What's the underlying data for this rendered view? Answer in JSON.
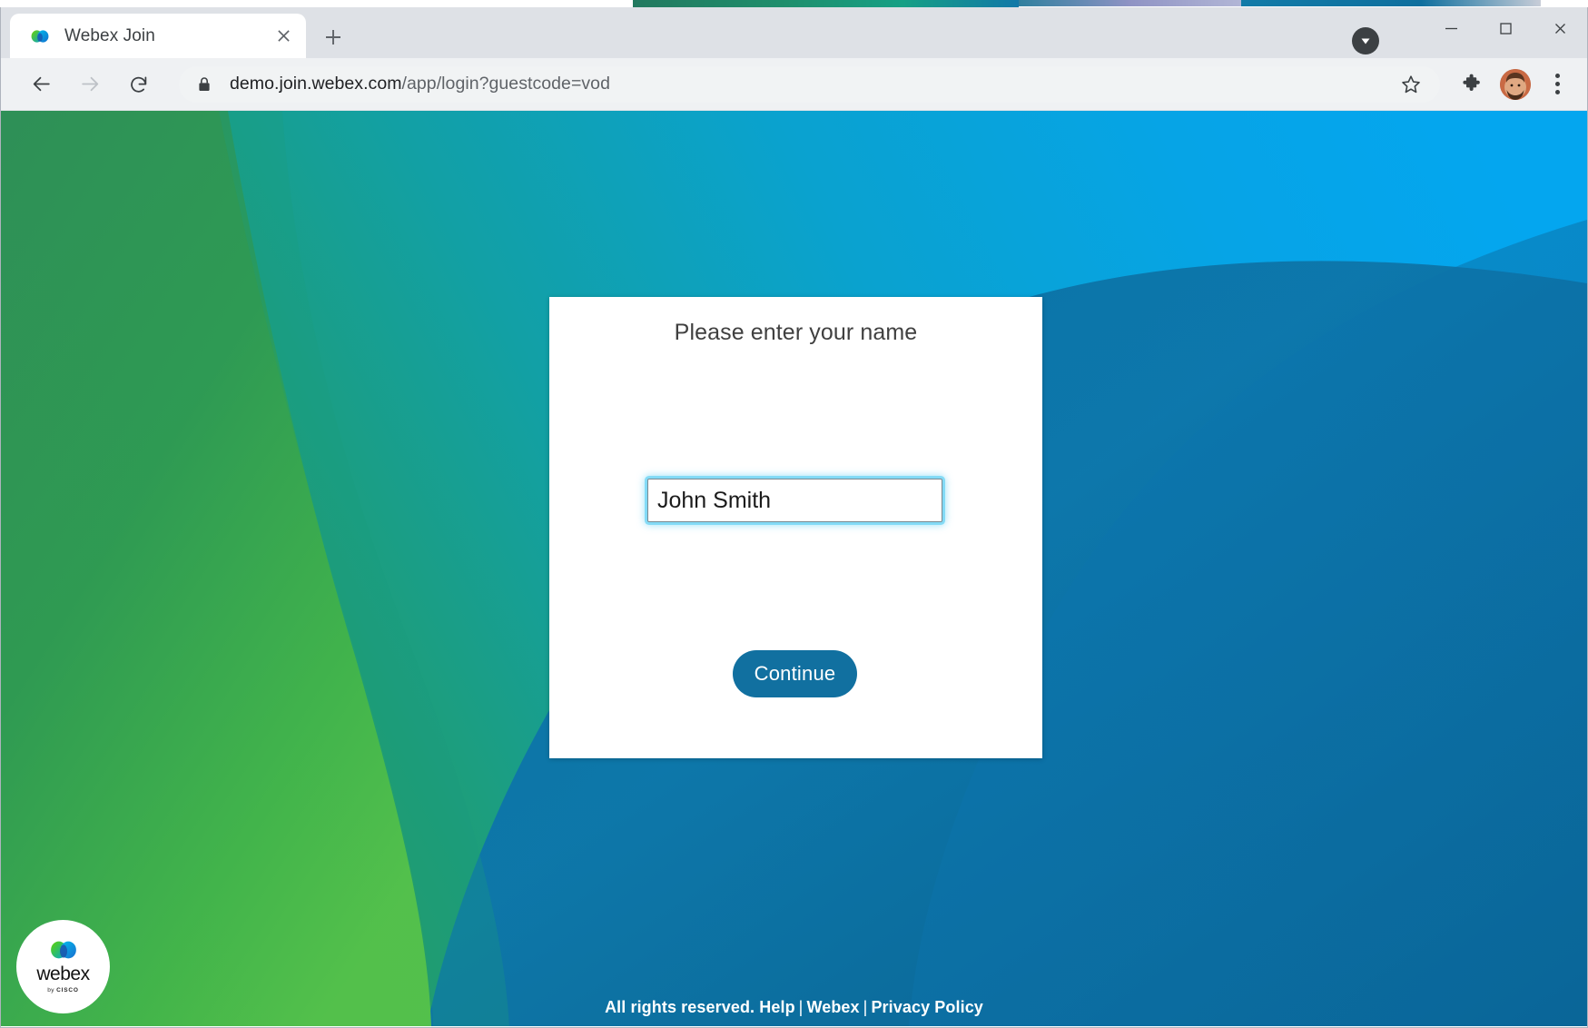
{
  "browser": {
    "tab": {
      "title": "Webex Join",
      "favicon_icon": "webex-logo-icon",
      "close_icon": "close-icon"
    },
    "new_tab_icon": "plus-icon",
    "download_icon": "download-arrow-icon",
    "window_controls": {
      "minimize_icon": "minimize-icon",
      "maximize_icon": "maximize-icon",
      "close_icon": "window-close-icon"
    },
    "toolbar": {
      "back_icon": "arrow-left-icon",
      "forward_icon": "arrow-right-icon",
      "reload_icon": "reload-icon",
      "lock_icon": "lock-icon",
      "url_host": "demo.join.webex.com",
      "url_path": "/app/login?guestcode=vod",
      "url_full": "demo.join.webex.com/app/login?guestcode=vod",
      "bookmark_icon": "star-icon",
      "extensions_icon": "puzzle-piece-icon",
      "avatar_icon": "profile-avatar",
      "menu_icon": "three-dot-menu-icon"
    }
  },
  "page": {
    "card": {
      "title": "Please enter your name",
      "name_field": {
        "value": "John Smith",
        "placeholder": ""
      },
      "continue_label": "Continue"
    },
    "badge": {
      "logo_icon": "webex-logo-icon",
      "wordmark": "webex",
      "tagline_prefix": "by ",
      "tagline_brand": "CISCO"
    },
    "footer": {
      "copyright": "All rights reserved.",
      "links": [
        "Help",
        "Webex",
        "Privacy Policy"
      ],
      "separator": "|"
    },
    "colors": {
      "accent_button": "#1170a0",
      "focus_ring": "#78d7f5",
      "bg_green": "#3aab4e",
      "bg_teal": "#17a08c",
      "bg_cyan": "#0fa6dd",
      "bg_blue": "#0d6fa4",
      "bg_deep_blue": "#0b5f8f"
    }
  }
}
